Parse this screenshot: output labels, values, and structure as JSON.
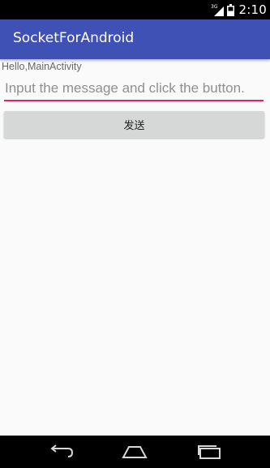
{
  "status_bar": {
    "network_type": "3G",
    "time": "2:10",
    "icons": [
      "signal-3g-icon",
      "battery-icon"
    ]
  },
  "app_bar": {
    "title": "SocketForAndroid",
    "color": "#3f51b5"
  },
  "main": {
    "hello_text": "Hello,MainActivity",
    "message_input": {
      "value": "",
      "placeholder": "Input the message and click the button."
    },
    "send_button_label": "发送"
  },
  "nav_bar": {
    "buttons": [
      "back-icon",
      "home-icon",
      "recents-icon"
    ]
  },
  "colors": {
    "accent": "#e91e63",
    "primary": "#3f51b5",
    "button_bg": "#d6d7d7"
  }
}
